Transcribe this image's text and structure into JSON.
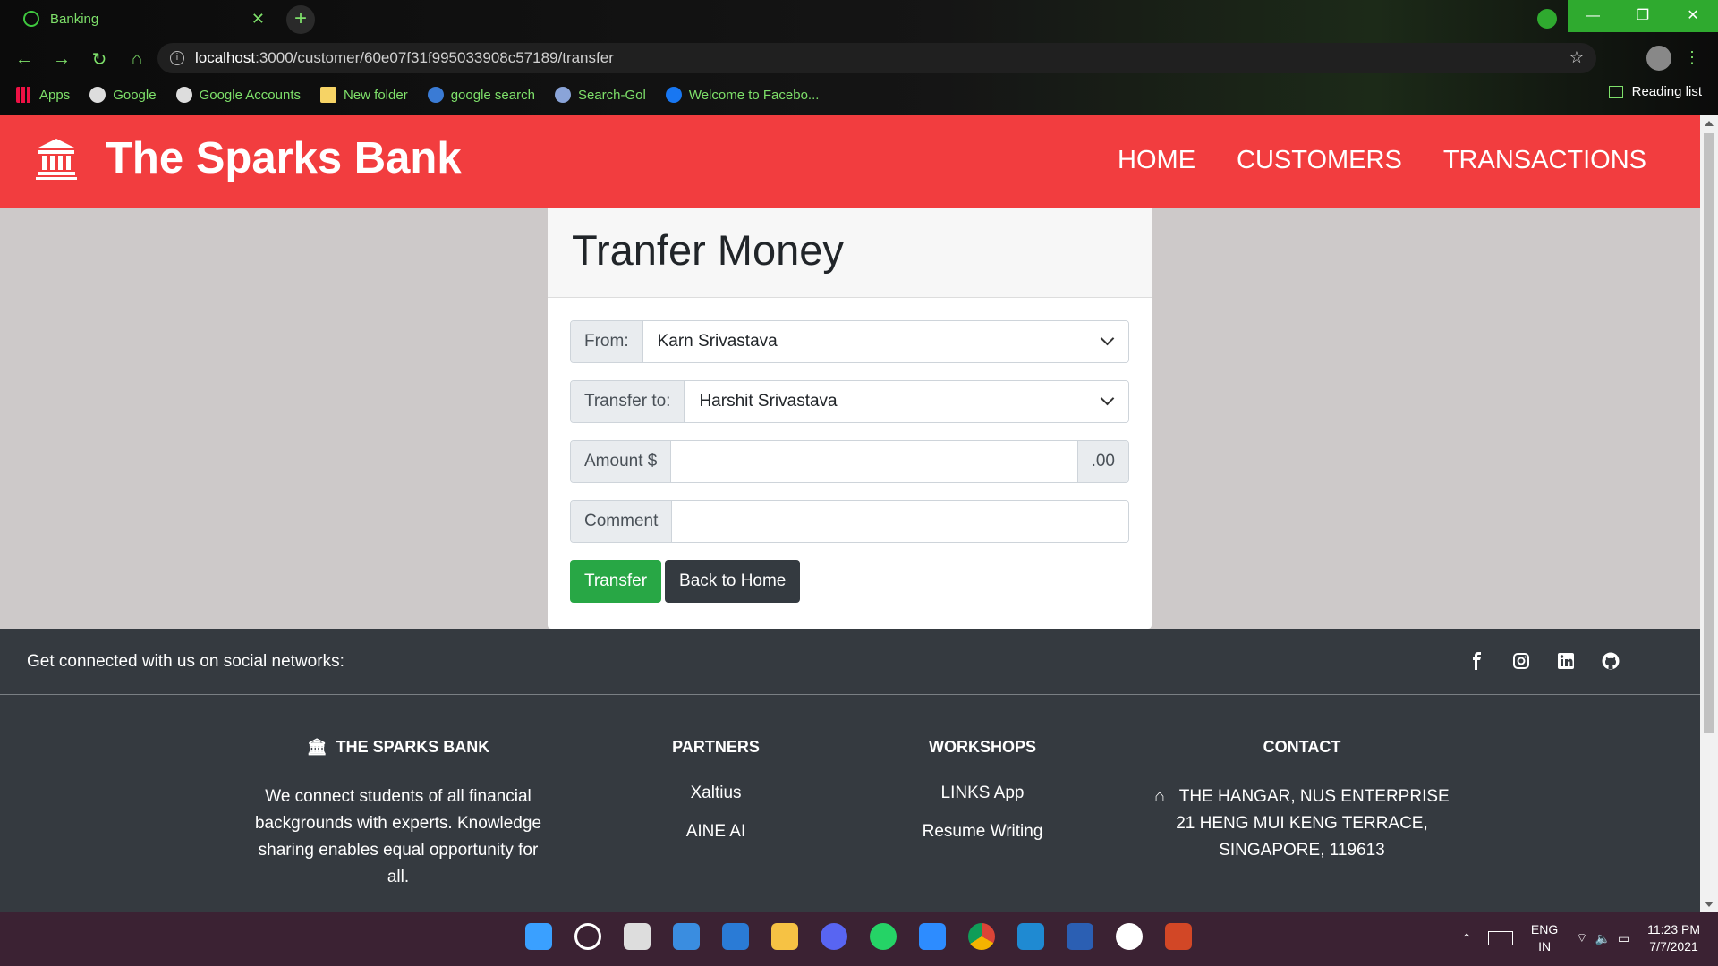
{
  "browser": {
    "tab_title": "Banking",
    "new_tab": "+",
    "url_host": "localhost",
    "url_path": ":3000/customer/60e07f31f995033908c57189/transfer",
    "bookmarks": [
      {
        "label": "Apps",
        "icon": "apps-grid-icon"
      },
      {
        "label": "Google",
        "icon": "google-icon"
      },
      {
        "label": "Google Accounts",
        "icon": "google-icon"
      },
      {
        "label": "New folder",
        "icon": "folder-icon"
      },
      {
        "label": "google search",
        "icon": "globe-icon"
      },
      {
        "label": "Search-Gol",
        "icon": "search-gol-icon"
      },
      {
        "label": "Welcome to Facebo...",
        "icon": "facebook-icon"
      }
    ],
    "reading_list": "Reading list",
    "accent_color": "#7ee06a"
  },
  "header": {
    "brand": "The Sparks Bank",
    "nav": [
      "HOME",
      "CUSTOMERS",
      "TRANSACTIONS"
    ],
    "color": "#f23d3f"
  },
  "card": {
    "title": "Tranfer Money",
    "from_label": "From:",
    "from_value": "Karn Srivastava",
    "to_label": "Transfer to:",
    "to_value": "Harshit Srivastava",
    "amount_label": "Amount $",
    "amount_suffix": ".00",
    "amount_value": "",
    "comment_label": "Comment",
    "comment_value": "",
    "transfer_button": "Transfer",
    "back_button": "Back to Home"
  },
  "footer": {
    "social_text": "Get connected with us on social networks:",
    "social_icons": [
      "facebook-icon",
      "instagram-icon",
      "linkedin-icon",
      "github-icon"
    ],
    "about_title": "THE SPARKS BANK",
    "about_lines": [
      "We connect students of all financial",
      "backgrounds with experts. Knowledge",
      "sharing enables equal opportunity for",
      "all."
    ],
    "partners_title": "PARTNERS",
    "partners": [
      "Xaltius",
      "AINE AI"
    ],
    "workshops_title": "WORKSHOPS",
    "workshops": [
      "LINKS App",
      "Resume Writing"
    ],
    "contact_title": "CONTACT",
    "contact_lines": [
      "THE HANGAR, NUS ENTERPRISE",
      "21 HENG MUI KENG TERRACE,",
      "SINGAPORE, 119613"
    ]
  },
  "taskbar": {
    "lang_1": "ENG",
    "lang_2": "IN",
    "time": "11:23 PM",
    "date": "7/7/2021"
  }
}
